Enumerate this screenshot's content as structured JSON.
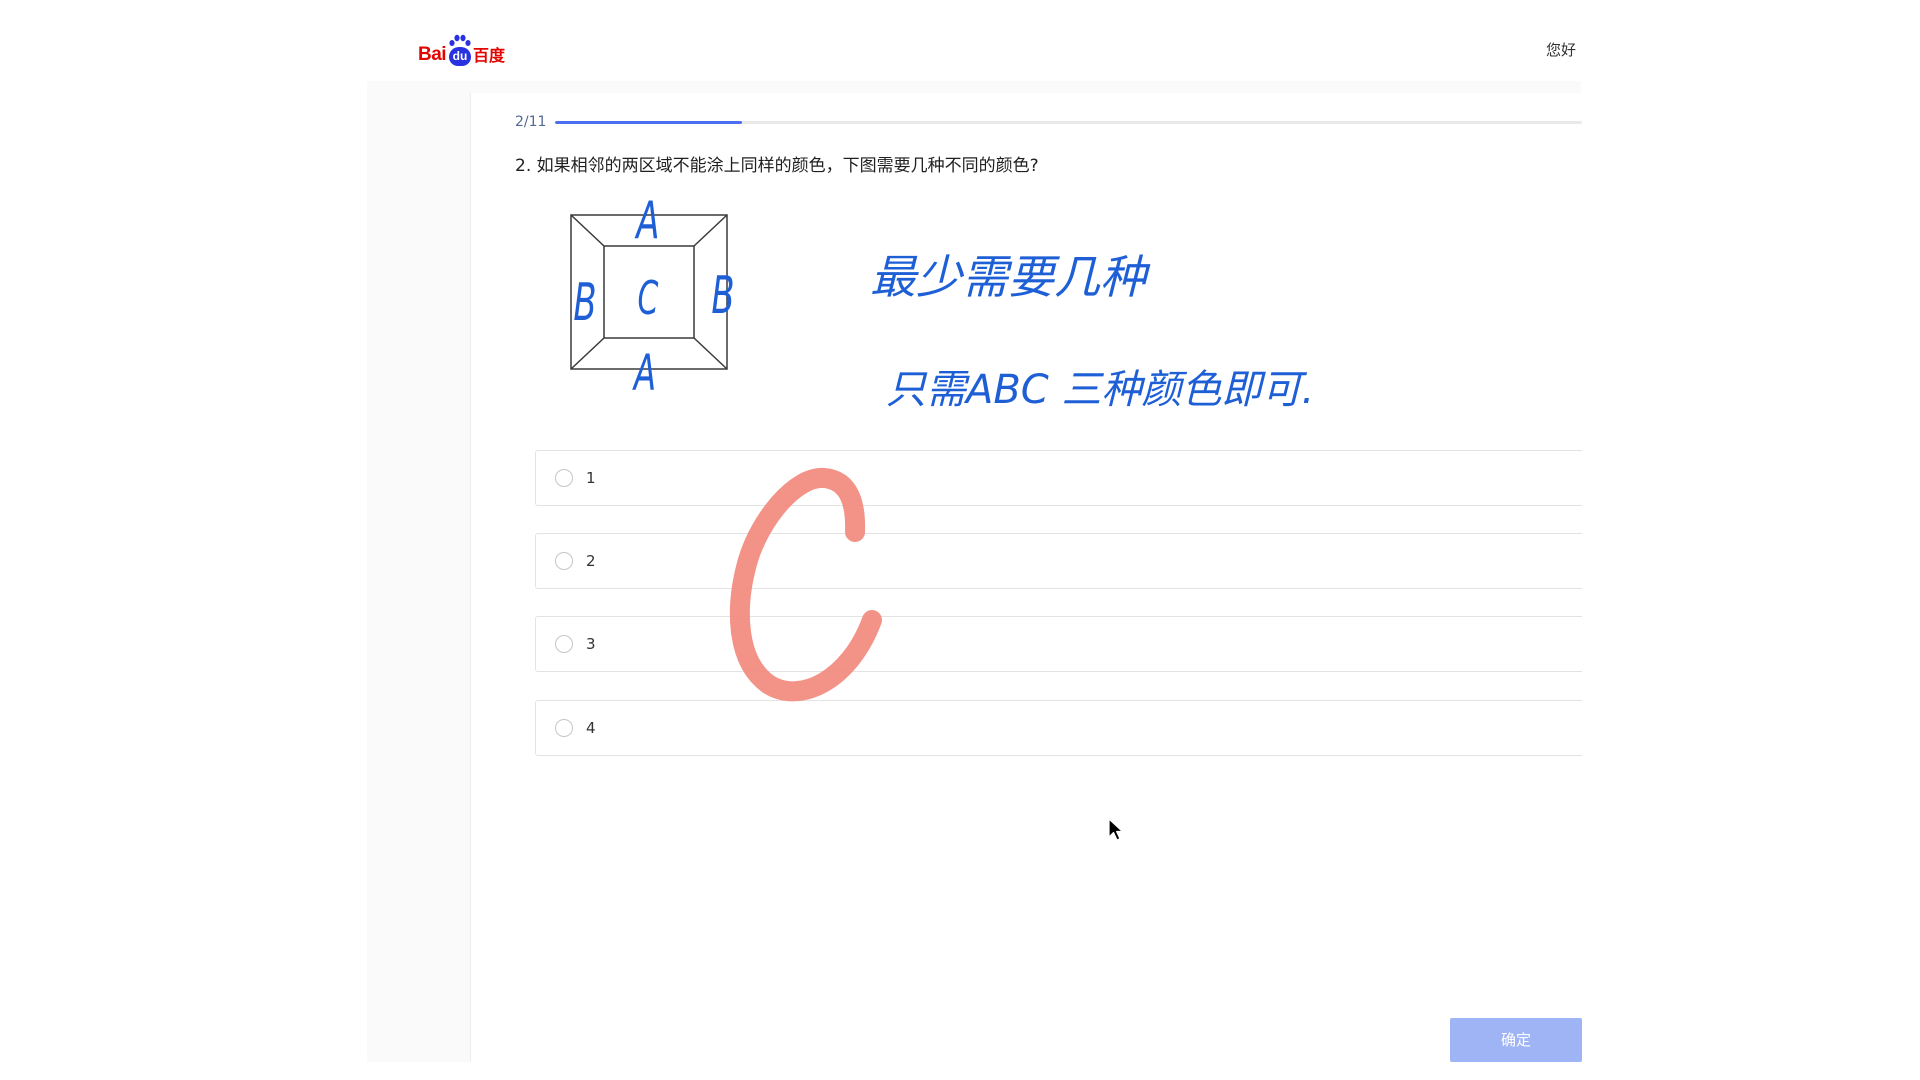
{
  "colors": {
    "brand_red": "#e10602",
    "brand_blue": "#2932e1",
    "accent": "#4e6ef2",
    "confirm": "#9fb4f5",
    "pen": "#1f5fd6",
    "mark": "#f28a7e"
  },
  "header": {
    "logo": {
      "bai": "Bai",
      "du": "du",
      "cn": "百度"
    },
    "greeting": "您好"
  },
  "progress": {
    "label": "2/11",
    "current": 2,
    "total": 11
  },
  "question": {
    "text": "2. 如果相邻的两区域不能涂上同样的颜色，下图需要几种不同的颜色?"
  },
  "options": [
    {
      "label": "1"
    },
    {
      "label": "2"
    },
    {
      "label": "3"
    },
    {
      "label": "4"
    }
  ],
  "confirm_button": {
    "label": "确定"
  },
  "annotations": {
    "figure_labels": {
      "top": "A",
      "left": "B",
      "center": "C",
      "right": "B",
      "bottom": "A"
    },
    "note_line1": "最少需要几种",
    "note_line2": "只需ABC 三种颜色即可.",
    "answer_mark": "C"
  }
}
